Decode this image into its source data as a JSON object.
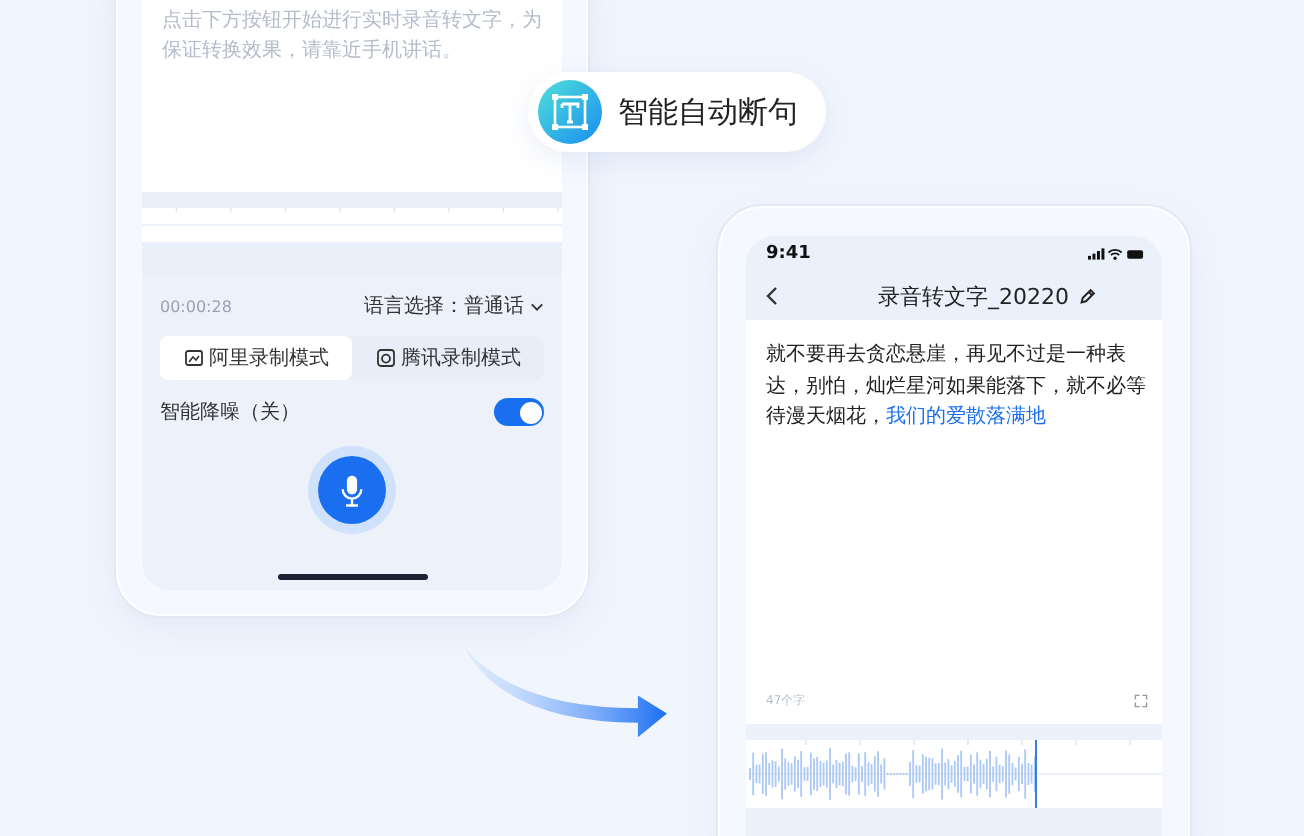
{
  "left_phone": {
    "hint_text": "点击下方按钮开始进行实时录音转文字，为保证转换效果，请靠近手机讲话。",
    "timer": "00:00:28",
    "language_label": "语言选择：普通话",
    "modes": [
      {
        "label": "阿里录制模式",
        "selected": true
      },
      {
        "label": "腾讯录制模式",
        "selected": false
      }
    ],
    "noise_reduction": {
      "label": "智能降噪（关）",
      "on": true
    }
  },
  "feature_badge": {
    "label": "智能自动断句"
  },
  "right_phone": {
    "time": "9:41",
    "title": "录音转文字_20220",
    "body": "就不要再去贪恋悬崖，再见不过是一种表达，别怕，灿烂星河如果能落下，就不必等待漫天烟花，",
    "link": "我们的爱散落满地",
    "word_count": "47个字"
  }
}
